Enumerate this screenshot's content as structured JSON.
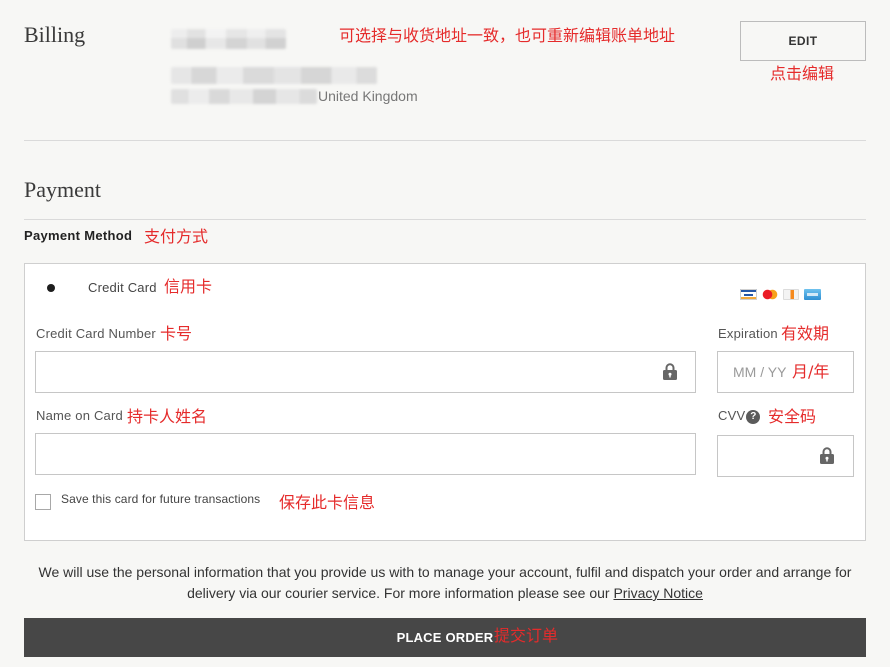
{
  "billing": {
    "title": "Billing",
    "address_country": "United Kingdom",
    "edit_label": "EDIT",
    "annotation": "可选择与收货地址一致，也可重新编辑账单地址",
    "edit_annotation": "点击编辑"
  },
  "payment": {
    "title": "Payment",
    "method_label": "Payment Method",
    "method_annotation": "支付方式",
    "option": {
      "label": "Credit Card",
      "annotation": "信用卡",
      "selected": true,
      "card_icons": [
        "visa-icon",
        "mastercard-icon",
        "discover-icon",
        "amex-icon"
      ]
    },
    "card_number": {
      "label": "Credit Card Number",
      "annotation": "卡号",
      "value": "",
      "icon": "lock-icon"
    },
    "expiration": {
      "label": "Expiration",
      "annotation": "有效期",
      "value": "",
      "placeholder": "MM / YY",
      "placeholder_annotation": "月/年"
    },
    "name_on_card": {
      "label": "Name on Card",
      "annotation": "持卡人姓名",
      "value": ""
    },
    "cvv": {
      "label": "CVV",
      "annotation": "安全码",
      "value": "",
      "help_icon": "question-circle-icon",
      "icon": "lock-icon"
    },
    "save_card": {
      "label": "Save this card for future transactions",
      "annotation": "保存此卡信息",
      "checked": false
    }
  },
  "notice": {
    "text": "We will use the personal information that you provide us with to manage your account, fulfil and dispatch your order and arrange for delivery via our courier service. For more information please see our",
    "link_label": "Privacy Notice"
  },
  "place_order": {
    "label": "PLACE ORDER",
    "annotation": "提交订单"
  },
  "colors": {
    "annotation": "#e52b2b",
    "place_order_bg": "#474747",
    "page_bg": "#f7f7f5",
    "text": "#333333"
  }
}
